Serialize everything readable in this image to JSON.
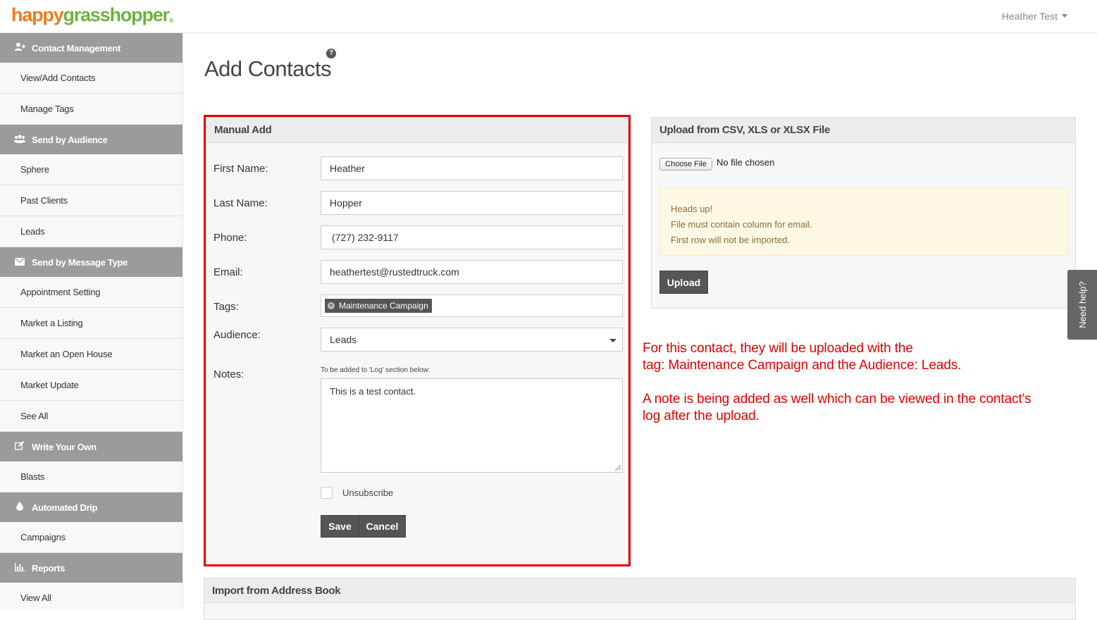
{
  "brand": {
    "logo_part1": "happy",
    "logo_part2": "grasshopper",
    "logo_mark": "®"
  },
  "header": {
    "user_name": "Heather Test"
  },
  "sidebar": {
    "sections": [
      {
        "label": "Contact Management",
        "icon": "user-plus-icon",
        "items": [
          "View/Add Contacts",
          "Manage Tags"
        ]
      },
      {
        "label": "Send by Audience",
        "icon": "users-icon",
        "items": [
          "Sphere",
          "Past Clients",
          "Leads"
        ]
      },
      {
        "label": "Send by Message Type",
        "icon": "envelope-icon",
        "items": [
          "Appointment Setting",
          "Market a Listing",
          "Market an Open House",
          "Market Update",
          "See All"
        ]
      },
      {
        "label": "Write Your Own",
        "icon": "edit-icon",
        "items": [
          "Blasts"
        ]
      },
      {
        "label": "Automated Drip",
        "icon": "drop-icon",
        "items": [
          "Campaigns"
        ]
      },
      {
        "label": "Reports",
        "icon": "bar-chart-icon",
        "items": [
          "View All"
        ]
      }
    ]
  },
  "page": {
    "title": "Add Contacts",
    "help_icon": "?"
  },
  "manual_add": {
    "title": "Manual Add",
    "first_name_label": "First Name:",
    "first_name_value": "Heather",
    "last_name_label": "Last Name:",
    "last_name_value": "Hopper",
    "phone_label": "Phone:",
    "phone_value": "(727) 232-9117",
    "email_label": "Email:",
    "email_value": "heathertest@rustedtruck.com",
    "tags_label": "Tags:",
    "tag_chip": "Maintenance Campaign",
    "tag_remove": "×",
    "audience_label": "Audience:",
    "audience_value": "Leads",
    "notes_label": "Notes:",
    "notes_hint": "To be added to 'Log' section below:",
    "notes_value": "This is a test contact.",
    "unsubscribe_label": "Unsubscribe",
    "save_label": "Save",
    "cancel_label": "Cancel"
  },
  "upload": {
    "title": "Upload from CSV, XLS or XLSX File",
    "choose_file_label": "Choose File",
    "no_file_text": "No file chosen",
    "alert_title": "Heads up!",
    "alert_line1": "File must contain column for email.",
    "alert_line2": "First row will not be imported.",
    "upload_label": "Upload"
  },
  "annotation": {
    "line1": "For this contact, they will be uploaded with the",
    "line2": "tag: Maintenance Campaign and the Audience: Leads.",
    "line3": "A note is being added as well which can be viewed in the contact's",
    "line4": "log after the upload."
  },
  "import": {
    "title": "Import from Address Book"
  },
  "need_help": {
    "label": "Need help?"
  },
  "colors": {
    "annotation_red": "#e00000",
    "brand_orange": "#ee7d1f",
    "brand_green": "#6db33f",
    "sidebar_head": "#9b9b9b",
    "button": "#555555"
  }
}
